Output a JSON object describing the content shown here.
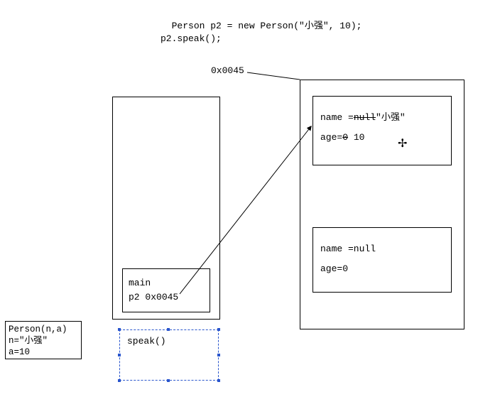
{
  "code": {
    "line1": "Person p2 = new Person(\"小强\", 10);",
    "line2": "p2.speak();"
  },
  "address_label": "0x0045",
  "stack": {
    "main_label": "main",
    "p2_label": "p2",
    "p2_value": "0x0045"
  },
  "heap": {
    "obj1": {
      "name_key": "name =",
      "name_old": "null",
      "name_new": "\"小强\"",
      "age_key": "age=",
      "age_old": "0",
      "age_new": "10"
    },
    "obj2": {
      "name_line": "name =null",
      "age_line": "age=0"
    }
  },
  "person_frame": {
    "line1": "Person(n,a)",
    "line2": "n=\"小强\"",
    "line3": "a=10"
  },
  "speak_frame": {
    "label": "speak()"
  }
}
